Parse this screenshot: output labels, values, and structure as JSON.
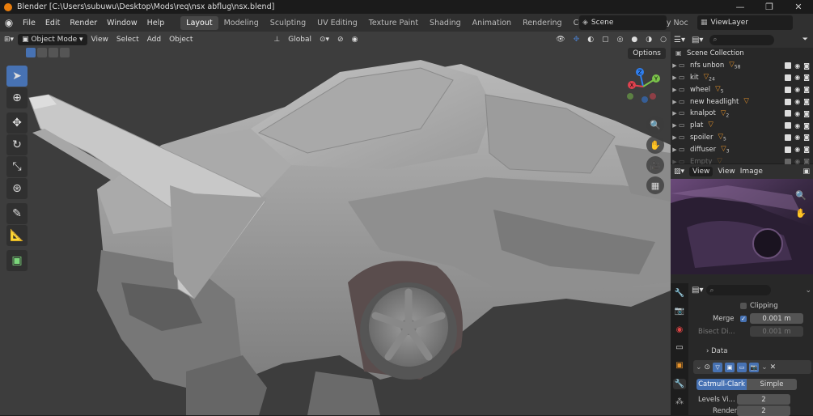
{
  "titlebar": {
    "title": "Blender [C:\\Users\\subuwu\\Desktop\\Mods\\req\\nsx abflug\\nsx.blend]",
    "minimize": "—",
    "maximize": "❐",
    "close": "✕"
  },
  "menu": {
    "items": [
      "File",
      "Edit",
      "Render",
      "Window",
      "Help"
    ]
  },
  "workspaces": [
    "Layout",
    "Modeling",
    "Sculpting",
    "UV Editing",
    "Texture Paint",
    "Shading",
    "Animation",
    "Rendering",
    "Compositing",
    "Geometry Noc"
  ],
  "active_workspace": "Layout",
  "scene": {
    "label": "Scene"
  },
  "viewlayer": {
    "label": "ViewLayer"
  },
  "viewport_header": {
    "mode": "Object Mode",
    "menus": [
      "View",
      "Select",
      "Add",
      "Object"
    ],
    "orientation": "Global",
    "options": "Options"
  },
  "gizmo": {
    "z": "Z",
    "y": "Y",
    "x": "X"
  },
  "outliner": {
    "collection": "Scene Collection",
    "rows": [
      {
        "name": "nfs unbon",
        "badge": "58"
      },
      {
        "name": "kit",
        "badge": "24"
      },
      {
        "name": "wheel",
        "badge": "5"
      },
      {
        "name": "new headlight",
        "badge": ""
      },
      {
        "name": "knalpot",
        "badge": "2"
      },
      {
        "name": "plat",
        "badge": ""
      },
      {
        "name": "spoiler",
        "badge": "5"
      },
      {
        "name": "diffuser",
        "badge": "3"
      },
      {
        "name": "Empty",
        "badge": ""
      }
    ]
  },
  "image_editor": {
    "menus": [
      "View",
      "View",
      "Image"
    ]
  },
  "properties": {
    "clipping": "Clipping",
    "merge_label": "Merge",
    "merge_value": "0.001 m",
    "bisect_label": "Bisect Di...",
    "bisect_value": "0.001 m",
    "data_section": "Data",
    "subdiv_tabs": [
      "Catmull-Clark",
      "Simple"
    ],
    "levels_label": "Levels Vi...",
    "levels_value": "2",
    "render_label": "Render",
    "render_value": "2"
  },
  "colors": {
    "accent": "#4772b3",
    "orange": "#e8932a",
    "viewport_bg": "#3d3d3d"
  }
}
